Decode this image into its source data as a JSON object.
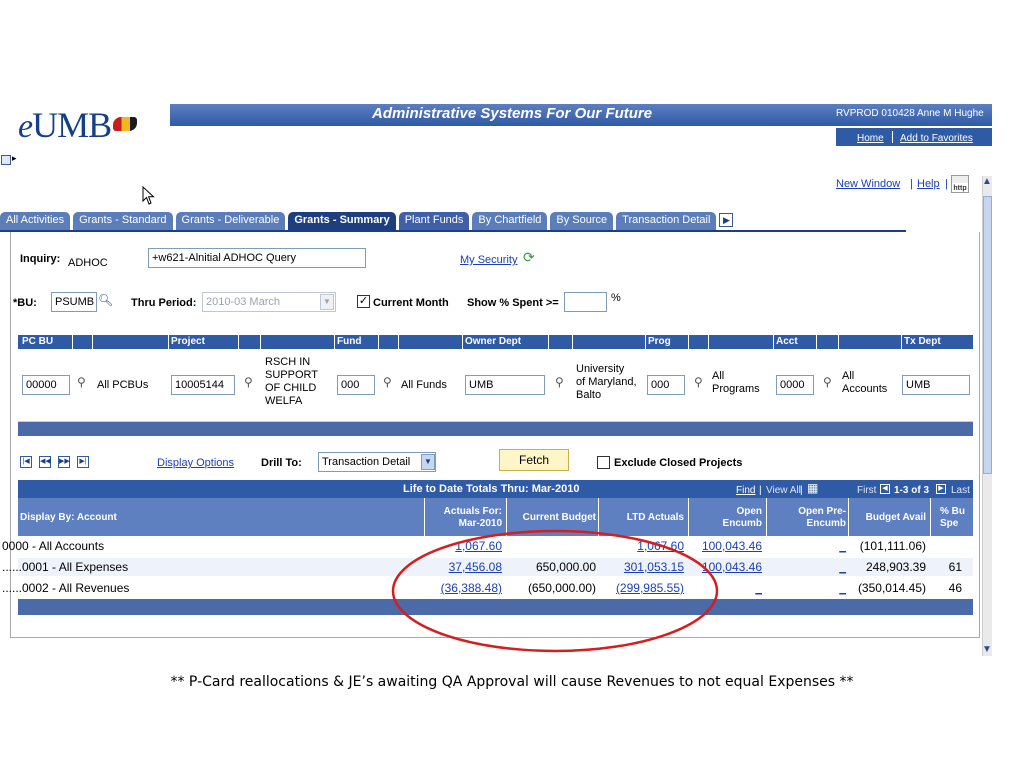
{
  "header": {
    "logo_text": "UMB",
    "logo_prefix": "e",
    "banner_title": "Administrative Systems For Our Future",
    "user_info": "RVPROD 010428 Anne M Hughe",
    "home_label": "Home",
    "favorites_label": "Add to Favorites"
  },
  "top_links": {
    "new_window": "New Window",
    "separator": "|",
    "help": "Help",
    "http_icon": "http"
  },
  "tabs": [
    {
      "label": "All Activities"
    },
    {
      "label": "Grants - Standard"
    },
    {
      "label": "Grants - Deliverable"
    },
    {
      "label": "Grants - Summary"
    },
    {
      "label": "Plant Funds"
    },
    {
      "label": "By Chartfield"
    },
    {
      "label": "By Source"
    },
    {
      "label": "Transaction Detail"
    }
  ],
  "inquiry": {
    "label": "Inquiry:",
    "value": "ADHOC",
    "description": "+w621-Alnitial ADHOC Query",
    "my_security": "My Security"
  },
  "criteria": {
    "bu_label": "*BU:",
    "bu_value": "PSUMB",
    "thru_period_label": "Thru Period:",
    "thru_period_value": "2010-03 March",
    "current_month_label": "Current Month",
    "show_spent_label": "Show % Spent >=",
    "show_spent_value": "",
    "percent": "%"
  },
  "grid_headers": {
    "pc_bu": "PC BU",
    "project": "Project",
    "fund": "Fund",
    "owner_dept": "Owner Dept",
    "prog": "Prog",
    "acct": "Acct",
    "tx_dept": "Tx Dept"
  },
  "grid_values": {
    "pc_bu": "00000",
    "pc_bu_desc": "All PCBUs",
    "project": "10005144",
    "project_desc": [
      "RSCH IN",
      "SUPPORT",
      "OF CHILD",
      "WELFA"
    ],
    "fund": "000",
    "fund_desc": "All Funds",
    "owner_dept": "UMB",
    "owner_dept_desc": [
      "University",
      "of Maryland,",
      "Balto"
    ],
    "prog": "000",
    "prog_desc": [
      "All",
      "Programs"
    ],
    "acct": "0000",
    "acct_desc": [
      "All",
      "Accounts"
    ],
    "tx_dept": "UMB"
  },
  "nav": {
    "display_options": "Display Options",
    "drill_to_label": "Drill To:",
    "drill_to_value": "Transaction Detail",
    "fetch_label": "Fetch",
    "exclude_closed": "Exclude Closed Projects"
  },
  "results": {
    "life_to_date_title": "Life to Date Totals Thru: Mar-2010",
    "find": "Find",
    "view_all": "View All",
    "first": "First",
    "range": "1-3 of 3",
    "last": "Last",
    "columns": {
      "display_by": "Display By: Account",
      "actuals_for": [
        "Actuals For:",
        "Mar-2010"
      ],
      "current_budget": "Current Budget",
      "ltd_actuals": "LTD Actuals",
      "open_encumb": [
        "Open",
        "Encumb"
      ],
      "open_pre_encumb": [
        "Open Pre-",
        "Encumb"
      ],
      "budget_avail": "Budget Avail",
      "pct_spent": [
        "% Bu",
        "Spe"
      ]
    },
    "rows": [
      {
        "account": "0000 - All Accounts",
        "actuals": "1,067.60",
        "budget": "",
        "ltd": "1,067.60",
        "open_encumb": "100,043.46",
        "pre_encumb": "_",
        "avail": "(101,111.06)",
        "pct": ""
      },
      {
        "account": "......0001 - All Expenses",
        "actuals": "37,456.08",
        "budget": "650,000.00",
        "ltd": "301,053.15",
        "open_encumb": "100,043.46",
        "pre_encumb": "_",
        "avail": "248,903.39",
        "pct": "61"
      },
      {
        "account": "......0002 - All Revenues",
        "actuals": "(36,388.48)",
        "budget": "(650,000.00)",
        "ltd": "(299,985.55)",
        "open_encumb": "_",
        "pre_encumb": "_",
        "avail": "(350,014.45)",
        "pct": "46"
      }
    ]
  },
  "note": "** P-Card reallocations & JE’s awaiting QA Approval will cause Revenues to not equal Expenses **",
  "colors": {
    "banner": "#2f5aa5",
    "active_tab": "#1d3f82",
    "oval": "#d21f1f",
    "link": "#1a3fb8"
  }
}
